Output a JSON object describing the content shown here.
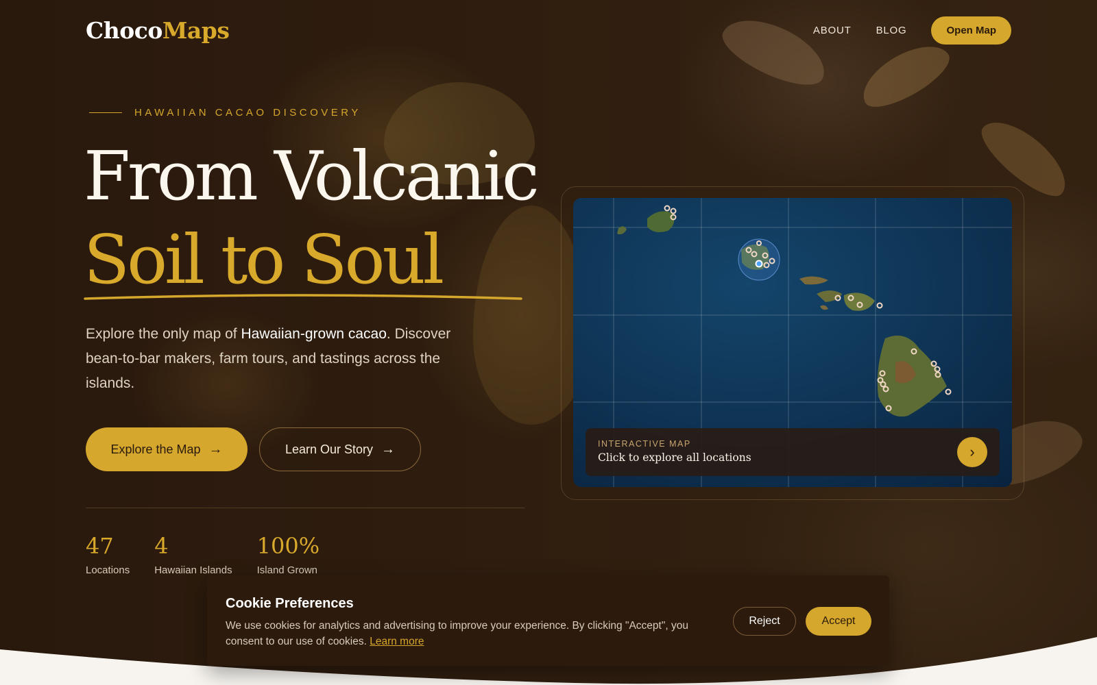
{
  "nav": {
    "logo_part1": "Choco",
    "logo_part2": "Maps",
    "links": [
      "ABOUT",
      "BLOG"
    ],
    "open_map_label": "Open Map"
  },
  "hero": {
    "eyebrow": "HAWAIIAN CACAO DISCOVERY",
    "title_line1": "From Volcanic",
    "title_line2": "Soil to Soul",
    "lead_part1": "Explore the only map of ",
    "lead_bold": "Hawaiian-grown cacao",
    "lead_part2": ". Discover bean-to-bar makers, farm tours, and tastings across the islands.",
    "explore_label": "Explore the Map",
    "story_label": "Learn Our Story",
    "arrow_icon": "→"
  },
  "stats": [
    {
      "value": "47",
      "label": "Locations"
    },
    {
      "value": "4",
      "label": "Hawaiian Islands"
    },
    {
      "value": "100%",
      "label": "Island Grown"
    }
  ],
  "map_card": {
    "eyebrow": "INTERACTIVE MAP",
    "title": "Click to explore all locations",
    "chevron_icon": "›"
  },
  "cookie": {
    "title": "Cookie Preferences",
    "text": "We use cookies for analytics and advertising to improve your experience. By clicking \"Accept\", you consent to our use of cookies. ",
    "link": "Learn more",
    "reject_label": "Reject",
    "accept_label": "Accept"
  },
  "colors": {
    "accent": "#d5a72c",
    "background": "#2b1a0d",
    "ocean": "#0d2e4f"
  }
}
